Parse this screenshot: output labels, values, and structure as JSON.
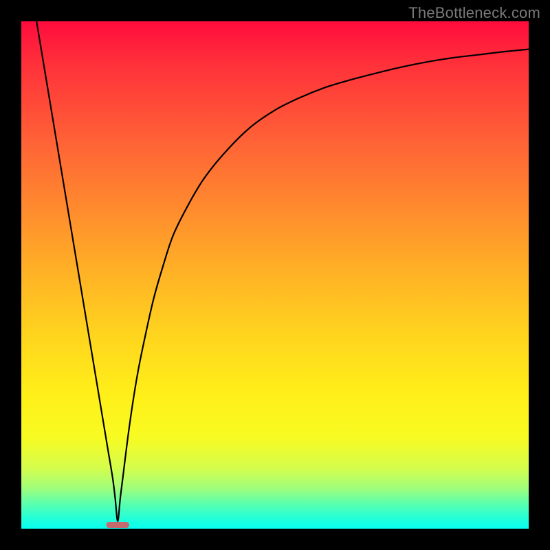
{
  "watermark": "TheBottleneck.com",
  "chart_data": {
    "type": "line",
    "title": "",
    "xlabel": "",
    "ylabel": "",
    "xlim": [
      0,
      100
    ],
    "ylim": [
      0,
      100
    ],
    "grid": false,
    "legend": false,
    "notes": "Color gradient background from red (top / high bottleneck) through orange / yellow to green (bottom / no bottleneck). Curve shows bottleneck severity vs parameter; minimum near x≈19.",
    "marker": {
      "x": 19,
      "y": 0,
      "width": 4.5,
      "color": "#c46a6f"
    },
    "series": [
      {
        "name": "bottleneck-curve",
        "x": [
          3,
          5,
          7,
          9,
          11,
          13,
          15,
          16,
          17,
          18,
          18.5,
          19,
          19.5,
          20,
          21,
          22,
          23,
          24,
          26,
          28,
          30,
          33,
          36,
          40,
          45,
          50,
          55,
          60,
          65,
          70,
          75,
          80,
          85,
          90,
          95,
          100
        ],
        "y": [
          100,
          88,
          76,
          64,
          52,
          40,
          28,
          22,
          16,
          10,
          6,
          1.5,
          6,
          10,
          18,
          25,
          31,
          36,
          45,
          52,
          58,
          64,
          69,
          74,
          79,
          82.5,
          85,
          87,
          88.5,
          89.8,
          91,
          92,
          92.8,
          93.4,
          94,
          94.5
        ]
      }
    ]
  }
}
